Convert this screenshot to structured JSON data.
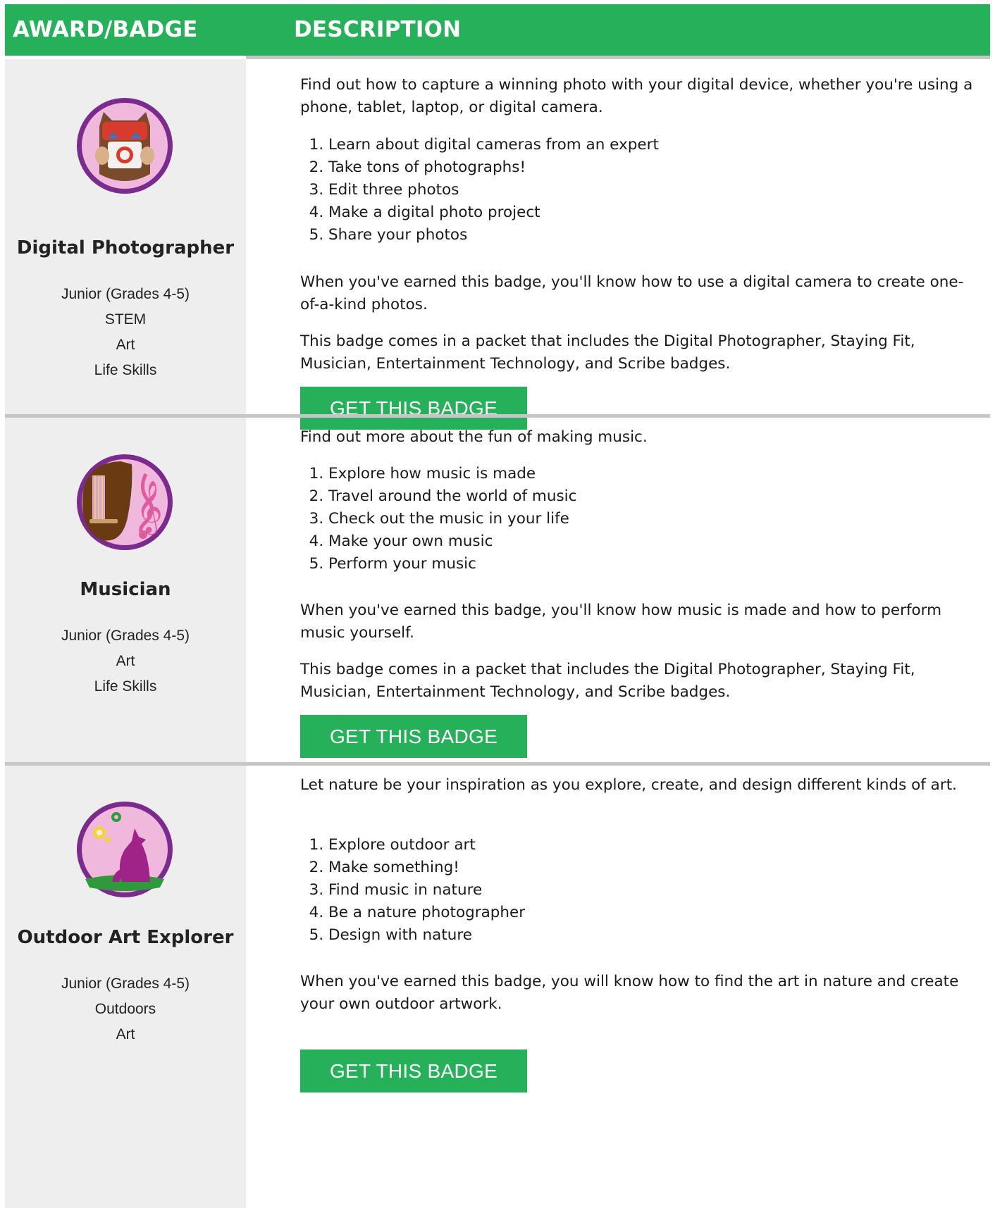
{
  "header": {
    "award_label": "AWARD/BADGE",
    "description_label": "DESCRIPTION"
  },
  "colors": {
    "green": "#26b05a",
    "left_bg": "#eeeeee",
    "separator": "#c6c6c6",
    "badge_ring": "#7b2a8e",
    "badge_fill": "#f0b8dc"
  },
  "badges": [
    {
      "icon": "camera-owl-badge-icon",
      "name": "Digital Photographer",
      "meta": [
        "Junior (Grades 4-5)",
        "STEM",
        "Art",
        "Life Skills"
      ],
      "intro": "Find out how to capture a winning photo with your digital device, whether you're using a phone, tablet, laptop, or digital camera.",
      "steps": [
        "Learn about digital cameras from an expert",
        "Take tons of photographs!",
        "Edit three photos",
        "Make a digital photo project",
        "Share your photos"
      ],
      "outcome": "When you've earned this badge, you'll know how to use a digital camera to create one-of-a-kind photos.",
      "packet": "This badge comes in a packet that includes the Digital Photographer, Staying Fit, Musician, Entertainment Technology, and Scribe badges.",
      "button": "GET THIS BADGE"
    },
    {
      "icon": "guitar-music-badge-icon",
      "name": "Musician",
      "meta": [
        "Junior (Grades 4-5)",
        "Art",
        "Life Skills"
      ],
      "intro": "Find out more about the fun of making music.",
      "steps": [
        "Explore how music is made",
        "Travel around the world of music",
        "Check out the music in your life",
        "Make your own music",
        "Perform your music"
      ],
      "outcome": "When you've earned this badge, you'll know how music is made and how to perform music yourself.",
      "packet": "This badge comes in a packet that includes the Digital Photographer, Staying Fit, Musician, Entertainment Technology, and Scribe badges.",
      "button": "GET THIS BADGE"
    },
    {
      "icon": "howling-wolf-flower-badge-icon",
      "name": "Outdoor Art Explorer",
      "meta": [
        "Junior (Grades 4-5)",
        "Outdoors",
        "Art"
      ],
      "intro": "Let nature be your inspiration as you explore, create, and design different kinds of art.",
      "steps": [
        "Explore outdoor art",
        "Make something!",
        "Find music in nature",
        "Be a nature photographer",
        "Design with nature"
      ],
      "outcome": "When you've earned this badge, you will know how to find the art in nature and create your own outdoor artwork.",
      "button": "GET THIS BADGE"
    }
  ]
}
